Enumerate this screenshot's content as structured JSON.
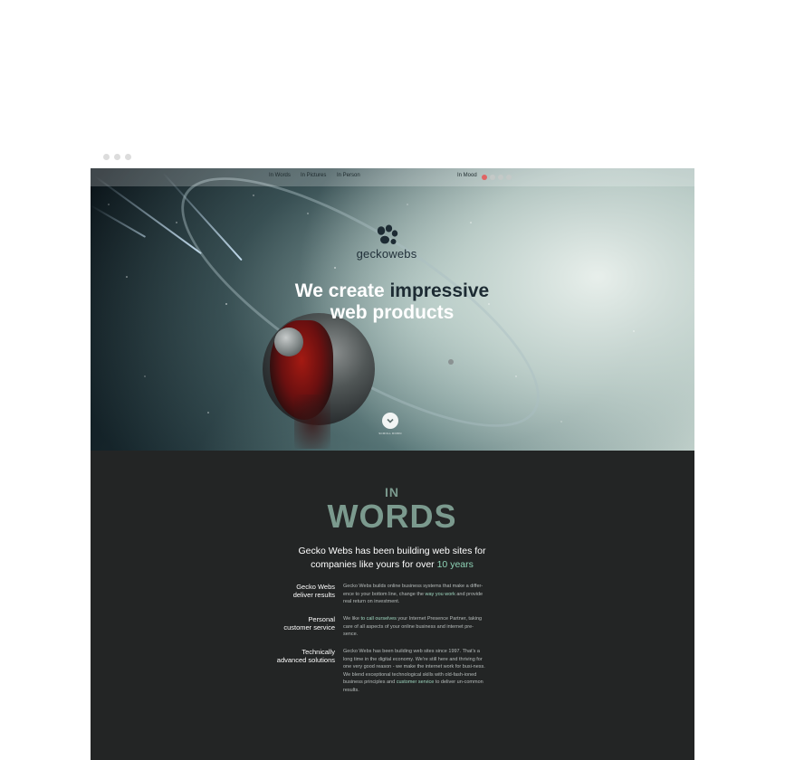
{
  "nav": {
    "items": [
      "In Words",
      "In Pictures",
      "In Person"
    ],
    "mood_label": "In Mood",
    "mood_count": 4,
    "mood_active_index": 0
  },
  "hero": {
    "logo_text": "geckowebs",
    "headline_part1": "We create ",
    "headline_part2": "impressive",
    "headline_line2": "web products",
    "scroll_label": "SCROLL DOWN"
  },
  "words_section": {
    "in_label": "IN",
    "words_label": "WORDS",
    "intro_line1": "Gecko Webs has been building web sites for",
    "intro_line2_prefix": "companies like yours for over ",
    "intro_highlight": "10 years",
    "features": [
      {
        "label_line1": "Gecko Webs",
        "label_line2": "deliver results",
        "text_parts": [
          "Gecko Webs builds online business systems that make a differ-ence to your bottom line, change the ",
          "way you work",
          " and provide real return on investment."
        ]
      },
      {
        "label_line1": "Personal",
        "label_line2": "customer service",
        "text_parts": [
          "We like ",
          "to call ourselves",
          " your Internet Presence Partner, taking care of all aspects of your online business and internet pre-sence."
        ]
      },
      {
        "label_line1": "Technically",
        "label_line2": "advanced solutions",
        "text_parts": [
          "Gecko Webs has been building web sites since 1997. That's a long time in the digital economy. We're still here and thriving for one very good reason - we make the internet work for busi-ness. We blend exceptional technological skills with old-fash-ioned business principles and ",
          "customer service",
          " to deliver un-common results."
        ]
      }
    ]
  },
  "colors": {
    "accent": "#8ed3b6",
    "section_bg": "#232525",
    "words_heading": "#7b9a8e",
    "mood_active": "#e06464"
  },
  "icons": {
    "logo": "gecko-paw-icon",
    "scroll": "chevron-down-icon"
  }
}
